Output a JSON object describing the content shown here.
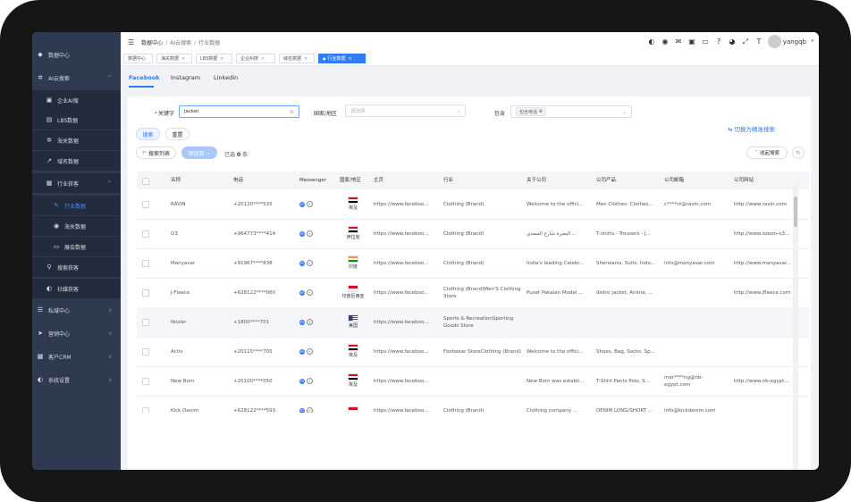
{
  "sidebar": {
    "items": [
      {
        "icon": "dashboard-icon",
        "glyph": "◆",
        "label": "数据中心",
        "chevron": ""
      },
      {
        "icon": "ai-search-icon",
        "glyph": "✲",
        "label": "AI云搜索",
        "chevron": "^"
      },
      {
        "icon": "enterprise-icon",
        "glyph": "▣",
        "label": "企业AI搜",
        "chevron": ""
      },
      {
        "icon": "lbs-icon",
        "glyph": "▤",
        "label": "LBS数据",
        "chevron": ""
      },
      {
        "icon": "customs-icon",
        "glyph": "✲",
        "label": "海关数据",
        "chevron": ""
      },
      {
        "icon": "domain-icon",
        "glyph": "↗",
        "label": "域名数据",
        "chevron": ""
      },
      {
        "icon": "industry-icon",
        "glyph": "▦",
        "label": "行业获客",
        "chevron": "^"
      },
      {
        "icon": "industry-data-icon",
        "glyph": "✎",
        "label": "行业数据",
        "chevron": ""
      },
      {
        "icon": "sea-data-icon",
        "glyph": "◉",
        "label": "海关数据",
        "chevron": ""
      },
      {
        "icon": "exhibition-icon",
        "glyph": "▭",
        "label": "展会数据",
        "chevron": ""
      },
      {
        "icon": "search-acquire-icon",
        "glyph": "⚲",
        "label": "搜索获客",
        "chevron": ""
      },
      {
        "icon": "social-icon",
        "glyph": "◐",
        "label": "社媒获客",
        "chevron": ""
      },
      {
        "icon": "private-icon",
        "glyph": "☰",
        "label": "私域中心",
        "chevron": "v"
      },
      {
        "icon": "marketing-icon",
        "glyph": "➤",
        "label": "营销中心",
        "chevron": "v"
      },
      {
        "icon": "crm-icon",
        "glyph": "▩",
        "label": "客户CRM",
        "chevron": "v"
      },
      {
        "icon": "settings-icon",
        "glyph": "◐",
        "label": "系统设置",
        "chevron": "v"
      }
    ]
  },
  "header": {
    "breadcrumb": [
      "数据中心",
      "AI云搜索",
      "行业数据"
    ],
    "icons": [
      {
        "name": "theme-icon",
        "glyph": "◐"
      },
      {
        "name": "whatsapp-icon",
        "glyph": "◉"
      },
      {
        "name": "mail-icon",
        "glyph": "✉"
      },
      {
        "name": "wechat-icon",
        "glyph": "▣"
      },
      {
        "name": "monitor-icon",
        "glyph": "▭"
      },
      {
        "name": "help-icon",
        "glyph": "?"
      },
      {
        "name": "globe-icon",
        "glyph": "◕"
      },
      {
        "name": "fullscreen-icon",
        "glyph": "⤢"
      },
      {
        "name": "font-size-icon",
        "glyph": "T"
      }
    ],
    "username": "yangqb"
  },
  "tags": [
    {
      "label": "数据中心",
      "closable": false,
      "active": false
    },
    {
      "label": "海关数据",
      "closable": true,
      "active": false
    },
    {
      "label": "LBS数据",
      "closable": true,
      "active": false
    },
    {
      "label": "企业AI搜",
      "closable": true,
      "active": false
    },
    {
      "label": "域名数据",
      "closable": true,
      "active": false
    },
    {
      "label": "行业数据",
      "closable": true,
      "active": true
    }
  ],
  "platform_tabs": [
    {
      "label": "Facebook",
      "active": true
    },
    {
      "label": "Instagram",
      "active": false
    },
    {
      "label": "Linkedin",
      "active": false
    }
  ],
  "search": {
    "keyword_label": "关键字",
    "keyword_value": "jacket",
    "region_label": "国家/地区",
    "region_placeholder": "请选择",
    "include_label": "包含",
    "include_chip": "包含电话",
    "search_button": "搜索",
    "reset_button": "重置",
    "switch_link": "切换为精准搜索",
    "search_list_button": "搜索列表",
    "add_to_button": "添加到",
    "selected_prefix": "已选",
    "selected_count": "0",
    "selected_suffix": "条",
    "collapse_button": "收起搜索"
  },
  "table": {
    "columns": [
      "名称",
      "电话",
      "Messenger",
      "国家/地区",
      "主页",
      "行业",
      "关于公司",
      "公司产品",
      "公司邮箱",
      "公司网站"
    ],
    "rows": [
      {
        "name": "RAVIN",
        "phone": "+20120****535",
        "flag": "egypt",
        "country": "埃及",
        "home": "https://www.faceboo...",
        "industry": "Clothing (Brand)",
        "about": "Welcome to the offici...",
        "products": "Men Clothes: Clothes...",
        "email": "c****ct@ravin.com",
        "website": "http://www.ravin.com"
      },
      {
        "name": "O3",
        "phone": "+964773****414",
        "flag": "iraq",
        "country": "伊拉克",
        "home": "https://www.faceboo...",
        "industry": "Clothing (Brand)",
        "about": "البصرة شارع السعدي ...",
        "products": "T-shirts - Trousers - J...",
        "email": "",
        "website": "http://www.ozoon-o3..."
      },
      {
        "name": "Manyavar",
        "phone": "+91967****838",
        "flag": "india",
        "country": "印度",
        "home": "https://www.faceboo...",
        "industry": "Clothing (Brand)",
        "about": "India's leading Celebr...",
        "products": "Sherwanis, Suits, Indo...",
        "email": "info@manyavar.com",
        "website": "http://www.manyavar..."
      },
      {
        "name": "J-Fleece",
        "phone": "+628122****060",
        "flag": "indonesia",
        "country": "印度尼西亚",
        "home": "https://www.faceboo...",
        "industry": "Clothing (Brand)Men'S Clothing Store",
        "about": "Pusat Pakaian Model ...",
        "products": "distro jacket, Anime, ...",
        "email": "",
        "website": "http://www.jfleece.com"
      },
      {
        "name": "Nosler",
        "phone": "+1800****701",
        "flag": "usa",
        "country": "美国",
        "home": "https://www.faceboo...",
        "industry": "Sports & RecreationSporting Goods Store",
        "about": "",
        "products": "",
        "email": "",
        "website": ""
      },
      {
        "name": "Activ",
        "phone": "+20115****705",
        "flag": "egypt",
        "country": "埃及",
        "home": "https://www.faceboo...",
        "industry": "Footwear StoreClothing (Brand)",
        "about": "Welcome to the offici...",
        "products": "Shoes, Bag, Socks, Sp...",
        "email": "",
        "website": ""
      },
      {
        "name": "New Born",
        "phone": "+20100****050",
        "flag": "egypt",
        "country": "埃及",
        "home": "https://www.faceboo...",
        "industry": "",
        "about": "New Born was establi...",
        "products": "T-Shirt Pants Polo, S...",
        "email": "mar****ng@nb-egypt.com",
        "website": "http://www.nb-egypt..."
      },
      {
        "name": "Kick Denim",
        "phone": "+628122****593",
        "flag": "indonesia",
        "country": "",
        "home": "https://www.faceboo...",
        "industry": "Clothing (Brand)",
        "about": "Clothing company ...",
        "products": "DENIM LONG/SHORT ...",
        "email": "info@kickdenim.com",
        "website": ""
      }
    ]
  },
  "colors": {
    "accent": "#2f7cf6",
    "sidebar": "#2e3a4f",
    "frame": "#161616"
  }
}
